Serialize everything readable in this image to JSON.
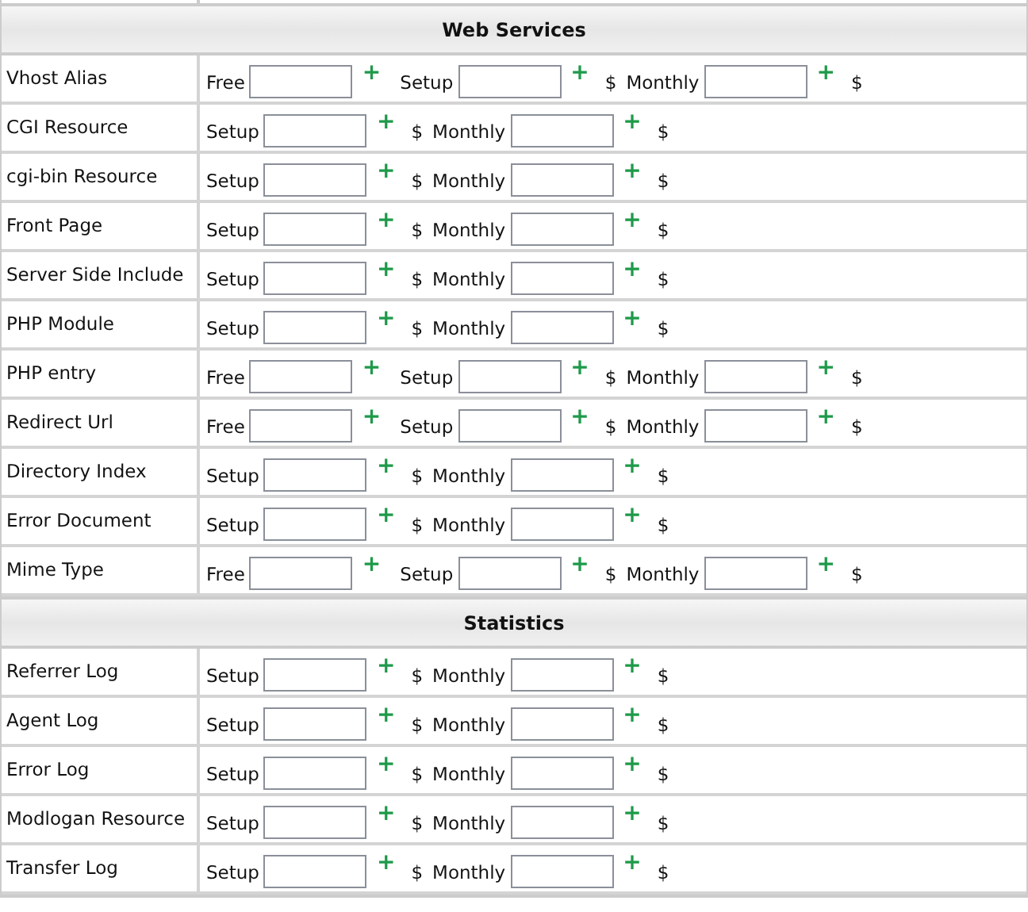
{
  "sections": [
    {
      "title": "Web Services",
      "rows": [
        {
          "label": "Vhost Alias",
          "fields": [
            {
              "label": "Free",
              "plus": "+"
            },
            {
              "label": "Setup",
              "plus": "+",
              "currency": "$"
            },
            {
              "label": "Monthly",
              "plus": "+",
              "currency": "$"
            }
          ]
        },
        {
          "label": "CGI Resource",
          "fields": [
            {
              "label": "Setup",
              "plus": "+",
              "currency": "$"
            },
            {
              "label": "Monthly",
              "plus": "+",
              "currency": "$"
            }
          ]
        },
        {
          "label": "cgi-bin Resource",
          "fields": [
            {
              "label": "Setup",
              "plus": "+",
              "currency": "$"
            },
            {
              "label": "Monthly",
              "plus": "+",
              "currency": "$"
            }
          ]
        },
        {
          "label": "Front Page",
          "fields": [
            {
              "label": "Setup",
              "plus": "+",
              "currency": "$"
            },
            {
              "label": "Monthly",
              "plus": "+",
              "currency": "$"
            }
          ]
        },
        {
          "label": "Server Side Include",
          "fields": [
            {
              "label": "Setup",
              "plus": "+",
              "currency": "$"
            },
            {
              "label": "Monthly",
              "plus": "+",
              "currency": "$"
            }
          ]
        },
        {
          "label": "PHP Module",
          "fields": [
            {
              "label": "Setup",
              "plus": "+",
              "currency": "$"
            },
            {
              "label": "Monthly",
              "plus": "+",
              "currency": "$"
            }
          ]
        },
        {
          "label": "PHP entry",
          "fields": [
            {
              "label": "Free",
              "plus": "+"
            },
            {
              "label": "Setup",
              "plus": "+",
              "currency": "$"
            },
            {
              "label": "Monthly",
              "plus": "+",
              "currency": "$"
            }
          ]
        },
        {
          "label": "Redirect Url",
          "fields": [
            {
              "label": "Free",
              "plus": "+"
            },
            {
              "label": "Setup",
              "plus": "+",
              "currency": "$"
            },
            {
              "label": "Monthly",
              "plus": "+",
              "currency": "$"
            }
          ]
        },
        {
          "label": "Directory Index",
          "fields": [
            {
              "label": "Setup",
              "plus": "+",
              "currency": "$"
            },
            {
              "label": "Monthly",
              "plus": "+",
              "currency": "$"
            }
          ]
        },
        {
          "label": "Error Document",
          "fields": [
            {
              "label": "Setup",
              "plus": "+",
              "currency": "$"
            },
            {
              "label": "Monthly",
              "plus": "+",
              "currency": "$"
            }
          ]
        },
        {
          "label": "Mime Type",
          "fields": [
            {
              "label": "Free",
              "plus": "+"
            },
            {
              "label": "Setup",
              "plus": "+",
              "currency": "$"
            },
            {
              "label": "Monthly",
              "plus": "+",
              "currency": "$"
            }
          ]
        }
      ]
    },
    {
      "title": "Statistics",
      "rows": [
        {
          "label": "Referrer Log",
          "fields": [
            {
              "label": "Setup",
              "plus": "+",
              "currency": "$"
            },
            {
              "label": "Monthly",
              "plus": "+",
              "currency": "$"
            }
          ]
        },
        {
          "label": "Agent Log",
          "fields": [
            {
              "label": "Setup",
              "plus": "+",
              "currency": "$"
            },
            {
              "label": "Monthly",
              "plus": "+",
              "currency": "$"
            }
          ]
        },
        {
          "label": "Error Log",
          "fields": [
            {
              "label": "Setup",
              "plus": "+",
              "currency": "$"
            },
            {
              "label": "Monthly",
              "plus": "+",
              "currency": "$"
            }
          ]
        },
        {
          "label": "Modlogan Resource",
          "fields": [
            {
              "label": "Setup",
              "plus": "+",
              "currency": "$"
            },
            {
              "label": "Monthly",
              "plus": "+",
              "currency": "$"
            }
          ]
        },
        {
          "label": "Transfer Log",
          "fields": [
            {
              "label": "Setup",
              "plus": "+",
              "currency": "$"
            },
            {
              "label": "Monthly",
              "plus": "+",
              "currency": "$"
            }
          ]
        }
      ]
    }
  ]
}
